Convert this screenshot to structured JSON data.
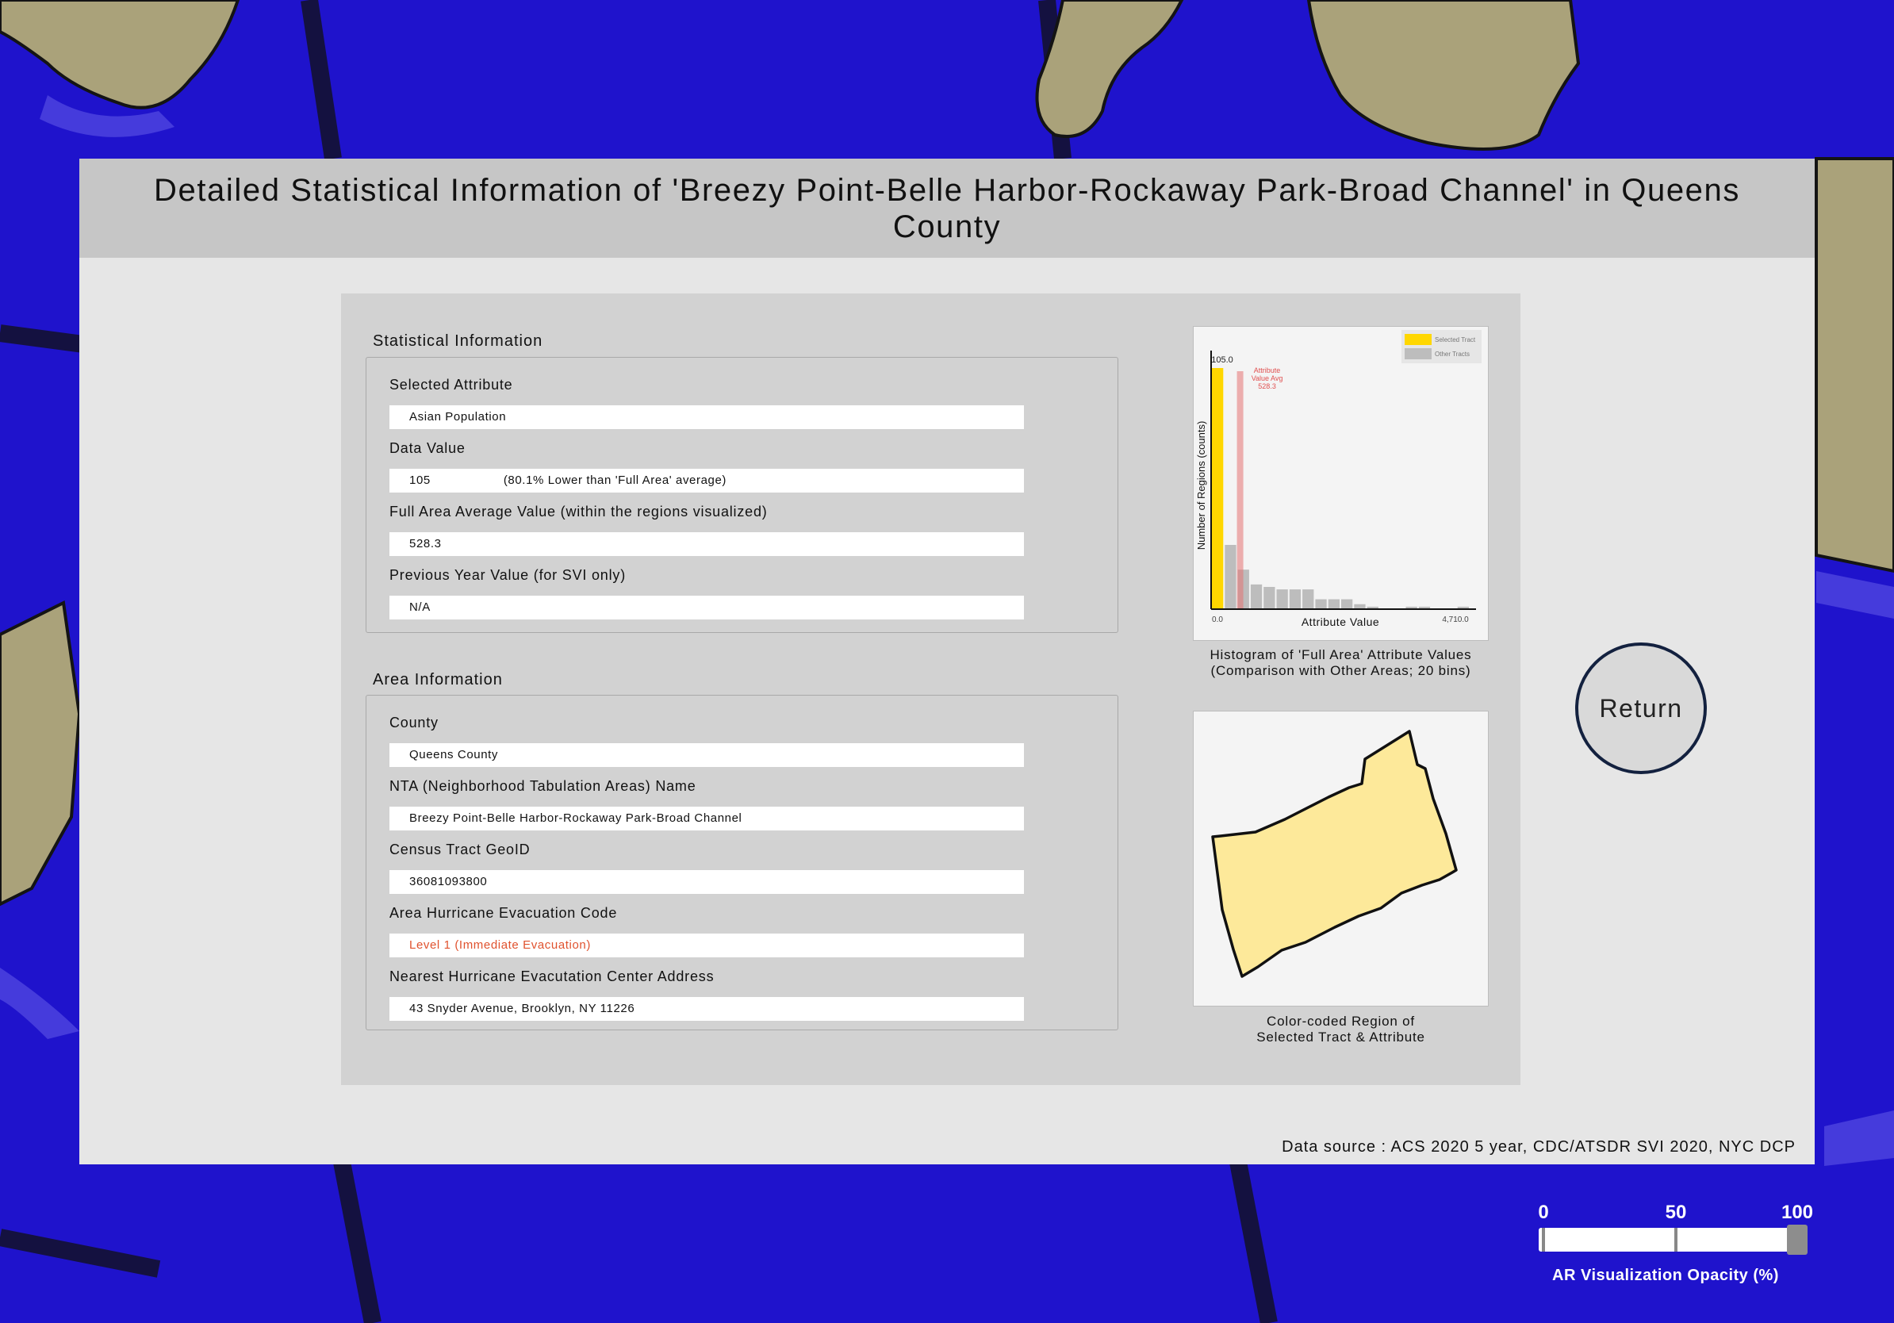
{
  "panel": {
    "title": "Detailed Statistical Information of 'Breezy Point-Belle Harbor-Rockaway Park-Broad Channel' in Queens County"
  },
  "statistical": {
    "section_title": "Statistical Information",
    "selected_attribute_label": "Selected Attribute",
    "selected_attribute_value": "Asian Population",
    "data_value_label": "Data Value",
    "data_value": "105",
    "data_value_note": "(80.1% Lower than 'Full Area' average)",
    "full_area_avg_label": "Full Area Average Value (within the regions visualized)",
    "full_area_avg_value": "528.3",
    "prev_year_label": "Previous Year Value (for SVI only)",
    "prev_year_value": "N/A"
  },
  "area": {
    "section_title": "Area Information",
    "county_label": "County",
    "county_value": "Queens County",
    "nta_label": "NTA (Neighborhood Tabulation Areas) Name",
    "nta_value": "Breezy Point-Belle Harbor-Rockaway Park-Broad Channel",
    "geoid_label": "Census Tract GeoID",
    "geoid_value": "36081093800",
    "evac_code_label": "Area Hurricane Evacuation Code",
    "evac_code_value": "Level 1 (Immediate Evacuation)",
    "evac_center_label": "Nearest Hurricane Evacutation Center Address",
    "evac_center_value": "43 Snyder Avenue, Brooklyn, NY 11226"
  },
  "histogram": {
    "caption_line1": "Histogram of 'Full Area' Attribute Values",
    "caption_line2": "(Comparison with Other Areas; 20 bins)"
  },
  "region_map": {
    "caption_line1": "Color-coded Region of",
    "caption_line2": "Selected Tract & Attribute"
  },
  "return_label": "Return",
  "data_source": "Data source : ACS 2020 5 year, CDC/ATSDR SVI 2020, NYC DCP",
  "opacity": {
    "caption": "AR Visualization Opacity (%)",
    "ticks": [
      "0",
      "50",
      "100"
    ],
    "value_percent": 100
  },
  "colors": {
    "selected_tract": "#ffd700",
    "other_tracts": "#bdbdbd",
    "avg_line": "#e57373",
    "region_fill": "#fde99a",
    "map_water": "#1e12c9",
    "map_land": "#a9a27a"
  },
  "chart_data": {
    "type": "bar",
    "xlabel": "Attribute Value",
    "ylabel": "Number of Regions (counts)",
    "xlim": [
      0.0,
      4710.0
    ],
    "x_tick_labels": [
      "0.0",
      "4,710.0"
    ],
    "bins": 20,
    "legend": {
      "placement": "top-right",
      "entries": [
        "Selected Tract",
        "Other Tracts"
      ]
    },
    "series": [
      {
        "name": "Selected Tract",
        "values": [
          105.0,
          0,
          0,
          0,
          0,
          0,
          0,
          0,
          0,
          0,
          0,
          0,
          0,
          0,
          0,
          0,
          0,
          0,
          0,
          0
        ]
      },
      {
        "name": "Other Tracts",
        "values": [
          0,
          26,
          16,
          10,
          9,
          8,
          8,
          8,
          4,
          4,
          4,
          2,
          1,
          0,
          0,
          1,
          1,
          0,
          0,
          1
        ]
      }
    ],
    "selected_value_label": "105.0",
    "average": {
      "value": 528.3,
      "label_lines": [
        "Attribute",
        "Value Avg",
        "528.3"
      ]
    }
  }
}
